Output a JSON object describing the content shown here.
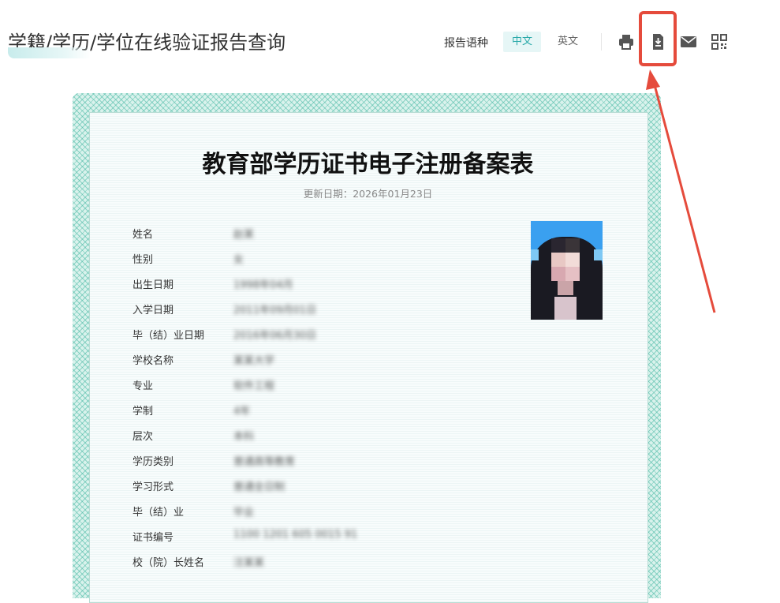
{
  "header": {
    "title": "学籍/学历/学位在线验证报告查询",
    "lang_label": "报告语种",
    "lang_zh": "中文",
    "lang_en": "英文"
  },
  "toolbar": {
    "icons": [
      "print-icon",
      "download-icon",
      "mail-icon",
      "qrcode-icon"
    ]
  },
  "certificate": {
    "title": "教育部学历证书电子注册备案表",
    "update_date": "更新日期：2026年01月23日",
    "fields": [
      {
        "label": "姓名",
        "value": "赵某"
      },
      {
        "label": "性别",
        "value": "女"
      },
      {
        "label": "出生日期",
        "value": "1998年04月"
      },
      {
        "label": "入学日期",
        "value": "2011年09月01日"
      },
      {
        "label": "毕（结）业日期",
        "value": "2016年06月30日"
      },
      {
        "label": "学校名称",
        "value": "某某大学"
      },
      {
        "label": "专业",
        "value": "软件工程"
      },
      {
        "label": "学制",
        "value": "4年"
      },
      {
        "label": "层次",
        "value": "本科"
      },
      {
        "label": "学历类别",
        "value": "普通高等教育"
      },
      {
        "label": "学习形式",
        "value": "普通全日制"
      },
      {
        "label": "毕（结）业",
        "value": "毕业"
      },
      {
        "label": "证书编号",
        "value": "1100 1201 605 0015 91"
      },
      {
        "label": "校（院）长姓名",
        "value": "汪某某"
      }
    ]
  },
  "colors": {
    "accent": "#2aa9a9",
    "annotation": "#e54b3c",
    "frame": "#48b8a4"
  }
}
